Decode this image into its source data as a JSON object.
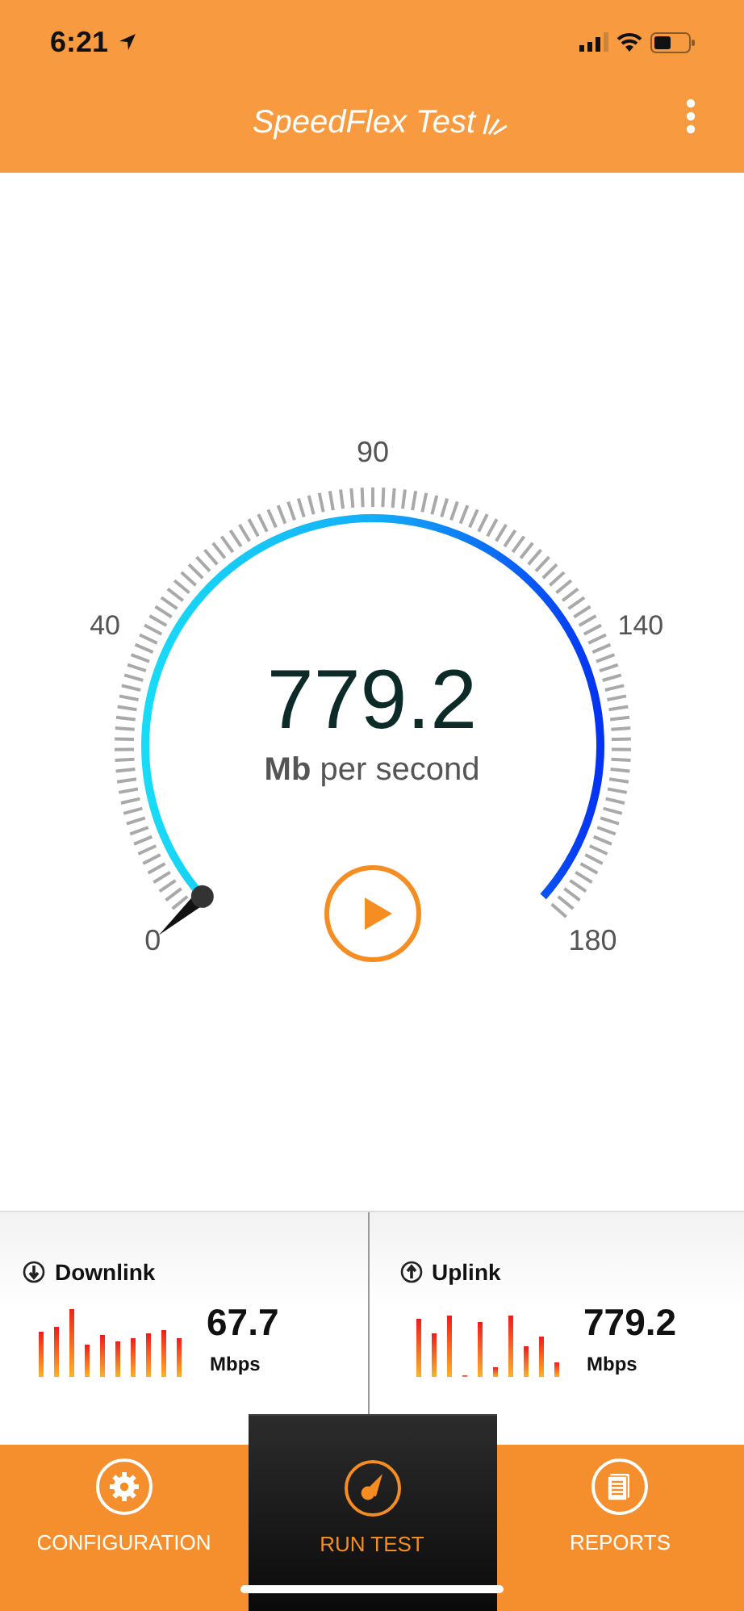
{
  "status_bar": {
    "time": "6:21"
  },
  "app_bar": {
    "title": "SpeedFlex Test"
  },
  "gauge": {
    "scale_labels": [
      "0",
      "40",
      "90",
      "140",
      "180"
    ],
    "value": "779.2",
    "unit": "**Mb** per second"
  },
  "stats": [
    {
      "label": "Downlink",
      "value": "67.7",
      "unit": "Mbps"
    },
    {
      "label": "Uplink",
      "value": "779.2",
      "unit": "Mbps"
    }
  ],
  "tabs": [
    {
      "label": "CONFIGURATION",
      "selected": false
    },
    {
      "label": "RUN TEST",
      "selected": true
    },
    {
      "label": "REPORTS",
      "selected": false
    }
  ]
}
